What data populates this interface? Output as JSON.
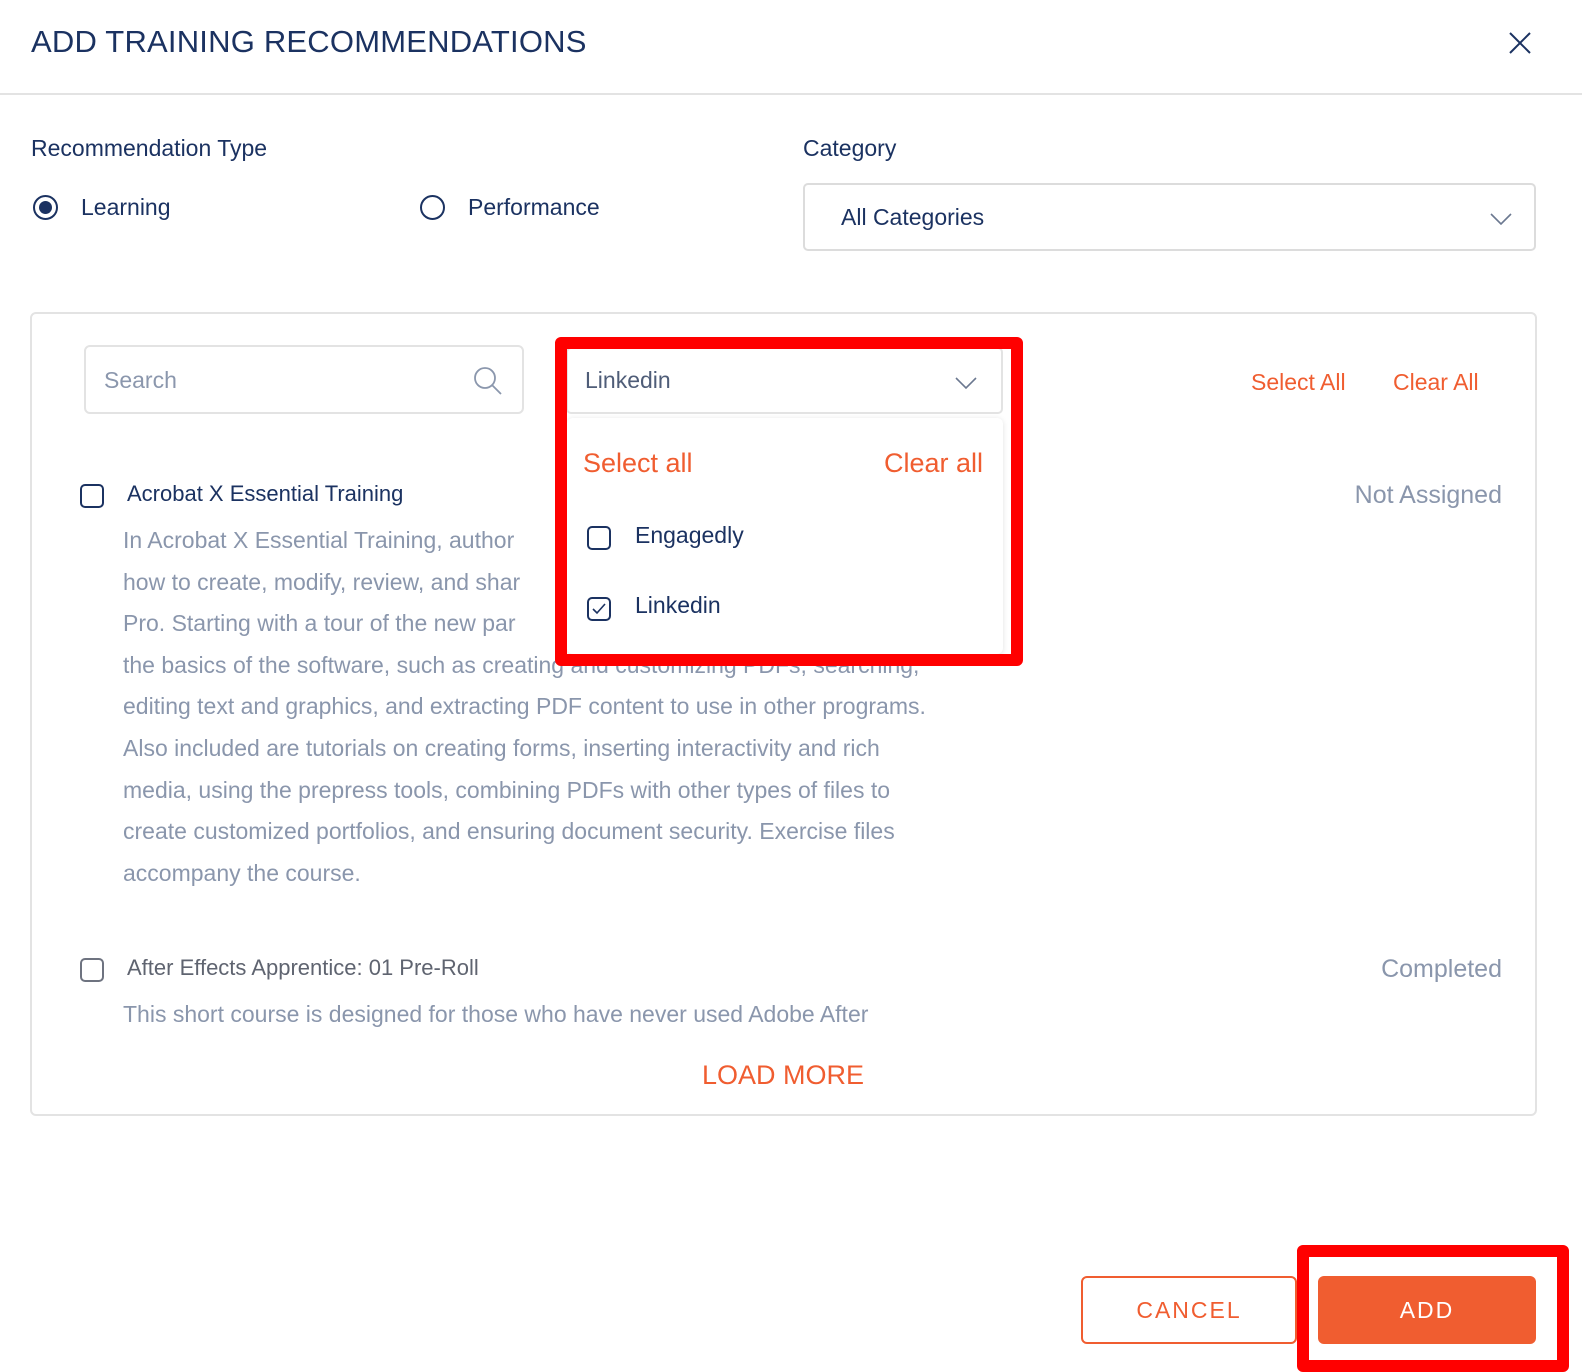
{
  "dialog": {
    "title": "ADD TRAINING RECOMMENDATIONS",
    "close_icon": "close-icon"
  },
  "recommendation_type": {
    "label": "Recommendation Type",
    "options": [
      {
        "label": "Learning",
        "selected": true
      },
      {
        "label": "Performance",
        "selected": false
      }
    ]
  },
  "category": {
    "label": "Category",
    "selected": "All Categories",
    "icon": "chevron-down-icon"
  },
  "filters": {
    "search_placeholder": "Search",
    "search_value": "",
    "search_icon": "search-icon",
    "source_select": {
      "selected": "Linkedin",
      "icon": "chevron-down-icon",
      "open": true,
      "select_all_label": "Select all",
      "clear_all_label": "Clear all",
      "options": [
        {
          "label": "Engagedly",
          "checked": false
        },
        {
          "label": "Linkedin",
          "checked": true
        }
      ]
    },
    "select_all_label": "Select All",
    "clear_all_label": "Clear All"
  },
  "courses": [
    {
      "title": "Acrobat X Essential Training",
      "checked": false,
      "status": "Not Assigned",
      "description_lines": [
        "In Acrobat X Essential Training, author",
        "how to create, modify, review, and shar",
        "Pro. Starting with a tour of the new par",
        "the basics of the software, such as creating and customizing PDFs, searching,",
        "editing text and graphics, and extracting PDF content to use in other programs.",
        "Also included are tutorials on creating forms, inserting interactivity and rich",
        "media, using the prepress tools, combining PDFs with other types of files to",
        "create customized portfolios, and ensuring document security. Exercise files",
        "accompany the course."
      ]
    },
    {
      "title": "After Effects Apprentice: 01 Pre-Roll",
      "checked": false,
      "status": "Completed",
      "description_lines": [
        "This short course is designed for those who have never used Adobe After"
      ]
    }
  ],
  "load_more_label": "LOAD MORE",
  "footer": {
    "cancel_label": "CANCEL",
    "add_label": "ADD"
  },
  "colors": {
    "primary_navy": "#1b3261",
    "accent_orange": "#f05d30",
    "muted_text": "#8a96ac",
    "annotation_red": "#ff0000"
  }
}
